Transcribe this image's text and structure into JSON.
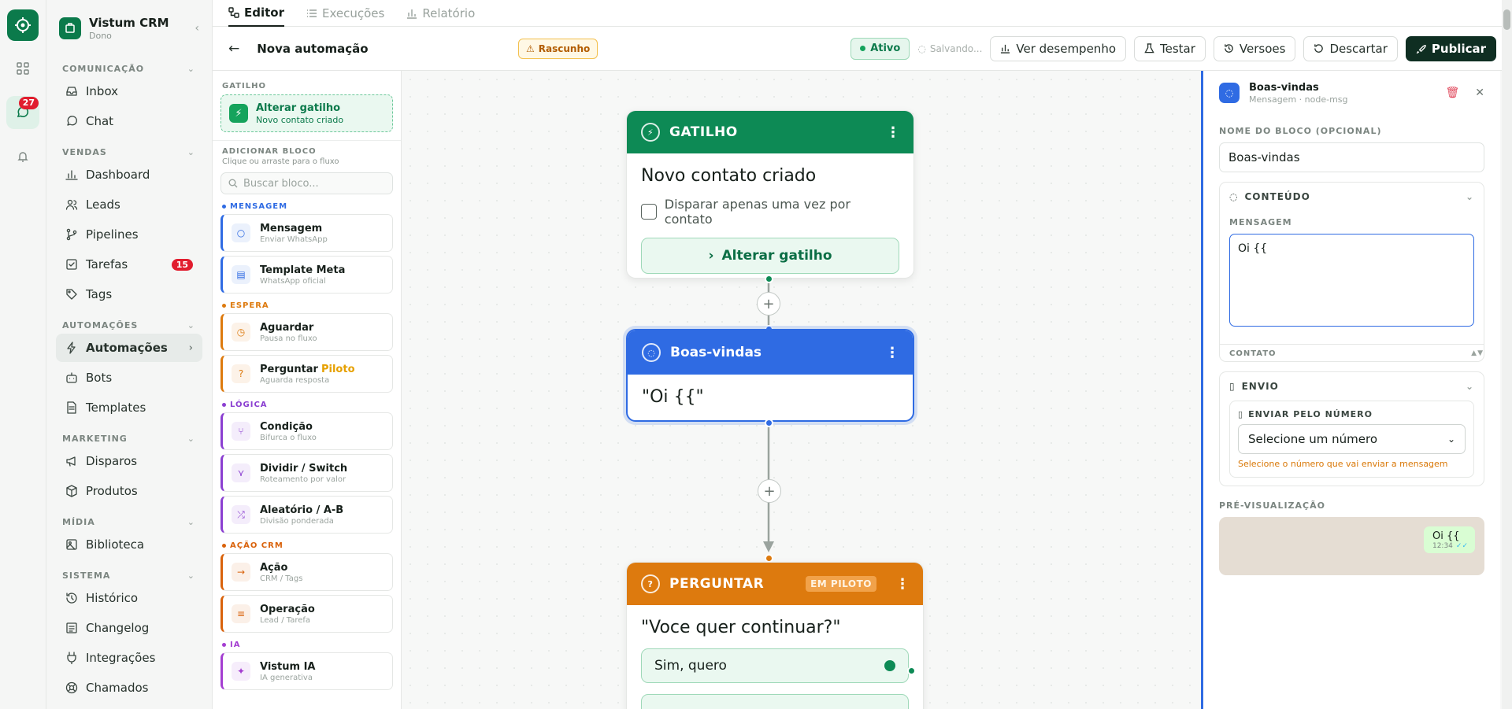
{
  "rail": {
    "badge": "27"
  },
  "brand": {
    "name": "Vistum CRM",
    "role": "Dono"
  },
  "nav": {
    "sections": [
      {
        "title": "COMUNICAÇÃO",
        "items": [
          {
            "label": "Inbox",
            "icon": "inbox-icon"
          },
          {
            "label": "Chat",
            "icon": "chat-icon"
          }
        ]
      },
      {
        "title": "VENDAS",
        "items": [
          {
            "label": "Dashboard",
            "icon": "bar-chart-icon"
          },
          {
            "label": "Leads",
            "icon": "users-icon"
          },
          {
            "label": "Pipelines",
            "icon": "branch-icon"
          },
          {
            "label": "Tarefas",
            "icon": "checklist-icon",
            "count": "15"
          },
          {
            "label": "Tags",
            "icon": "tag-icon"
          }
        ]
      },
      {
        "title": "AUTOMAÇÕES",
        "items": [
          {
            "label": "Automações",
            "icon": "bolt-icon",
            "active": true
          },
          {
            "label": "Bots",
            "icon": "bot-icon"
          },
          {
            "label": "Templates",
            "icon": "document-icon"
          }
        ]
      },
      {
        "title": "MARKETING",
        "items": [
          {
            "label": "Disparos",
            "icon": "megaphone-icon"
          },
          {
            "label": "Produtos",
            "icon": "box-icon"
          }
        ]
      },
      {
        "title": "MÍDIA",
        "items": [
          {
            "label": "Biblioteca",
            "icon": "image-icon"
          }
        ]
      },
      {
        "title": "SISTEMA",
        "items": [
          {
            "label": "Histórico",
            "icon": "history-icon"
          },
          {
            "label": "Changelog",
            "icon": "list-icon"
          },
          {
            "label": "Integrações",
            "icon": "plug-icon"
          },
          {
            "label": "Chamados",
            "icon": "help-icon"
          }
        ]
      }
    ]
  },
  "tabs": [
    {
      "label": "Editor",
      "active": true
    },
    {
      "label": "Execuções"
    },
    {
      "label": "Relatório"
    }
  ],
  "toolbar": {
    "title": "Nova automação",
    "draft": "Rascunho",
    "status": "Ativo",
    "saving": "Salvando...",
    "perf": "Ver desempenho",
    "test": "Testar",
    "versions": "Versoes",
    "discard": "Descartar",
    "publish": "Publicar"
  },
  "palette": {
    "trigger_head": "GATILHO",
    "trigger_title": "Alterar gatilho",
    "trigger_sub": "Novo contato criado",
    "add_head": "ADICIONAR BLOCO",
    "add_sub": "Clique ou arraste para o fluxo",
    "search_placeholder": "Buscar bloco...",
    "categories": [
      {
        "title": "MENSAGEM",
        "color": "#2f6be3",
        "items": [
          {
            "label": "Mensagem",
            "sub": "Enviar WhatsApp",
            "icon": "chat-icon"
          },
          {
            "label": "Template Meta",
            "sub": "WhatsApp oficial",
            "icon": "document-icon"
          }
        ]
      },
      {
        "title": "ESPERA",
        "color": "#dd7a0e",
        "items": [
          {
            "label": "Aguardar",
            "sub": "Pausa no fluxo",
            "icon": "clock-icon"
          },
          {
            "label": "Perguntar",
            "tag": "Piloto",
            "sub": "Aguarda resposta",
            "icon": "question-icon"
          }
        ]
      },
      {
        "title": "LÓGICA",
        "color": "#8b3fd1",
        "items": [
          {
            "label": "Condição",
            "sub": "Bifurca o fluxo",
            "icon": "branch-icon"
          },
          {
            "label": "Dividir / Switch",
            "sub": "Roteamento por valor",
            "icon": "split-icon"
          },
          {
            "label": "Aleatório / A-B",
            "sub": "Divisão ponderada",
            "icon": "shuffle-icon"
          }
        ]
      },
      {
        "title": "AÇÃO CRM",
        "color": "#d9620b",
        "items": [
          {
            "label": "Ação",
            "sub": "CRM / Tags",
            "icon": "arrow-icon"
          },
          {
            "label": "Operação",
            "sub": "Lead / Tarefa",
            "icon": "database-icon"
          }
        ]
      },
      {
        "title": "IA",
        "color": "#a43ed1",
        "items": [
          {
            "label": "Vistum IA",
            "sub": "IA generativa",
            "icon": "sparkle-icon"
          }
        ]
      }
    ]
  },
  "canvas": {
    "trigger": {
      "head": "GATILHO",
      "text": "Novo contato criado",
      "check_label": "Disparar apenas uma vez por contato",
      "button": "Alterar gatilho"
    },
    "message": {
      "head": "Boas-vindas",
      "text": "\"Oi {{\""
    },
    "ask": {
      "head": "PERGUNTAR",
      "badge": "EM PILOTO",
      "text": "\"Voce quer continuar?\"",
      "option": "Sim, quero"
    }
  },
  "inspector": {
    "title": "Boas-vindas",
    "subtitle": "Mensagem · node-msg",
    "name_label": "NOME DO BLOCO (OPCIONAL)",
    "name_value": "Boas-vindas",
    "content_head": "CONTEÚDO",
    "message_label": "MENSAGEM",
    "message_value": "Oi {{",
    "contact_tab": "CONTATO",
    "envio_head": "ENVIO",
    "send_label": "ENVIAR PELO NÚMERO",
    "select_value": "Selecione um número",
    "hint": "Selecione o número que vai enviar a mensagem",
    "preview_label": "PRÉ-VISUALIZAÇÃO",
    "preview_msg": "Oi {{",
    "preview_time": "12:34"
  },
  "colors": {
    "brand": "#0b7a4b",
    "message": "#2f6be3",
    "ask": "#dd7a0e",
    "trigger": "#0d8a55"
  }
}
